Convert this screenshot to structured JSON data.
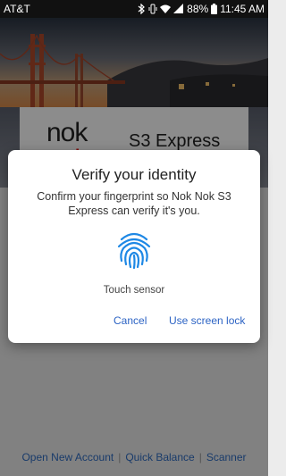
{
  "status_bar": {
    "carrier": "AT&T",
    "battery": "88%",
    "time": "11:45 AM",
    "icons": [
      "bluetooth-icon",
      "vibrate-icon",
      "wifi-icon",
      "signal-icon",
      "battery-icon"
    ]
  },
  "app": {
    "logo_text_top": "nok",
    "logo_text_bottom": "nok",
    "product_name": "S3 Express"
  },
  "bottom_links": [
    {
      "label": "Open New Account"
    },
    {
      "label": "Quick Balance"
    },
    {
      "label": "Scanner"
    }
  ],
  "dialog": {
    "title": "Verify your identity",
    "message": "Confirm your fingerprint so Nok Nok S3 Express can verify it's you.",
    "sensor_label": "Touch sensor",
    "cancel_label": "Cancel",
    "screen_lock_label": "Use screen lock",
    "icon": "fingerprint-icon"
  },
  "colors": {
    "accent": "#2c63c4",
    "logo_red": "#e22222",
    "fingerprint": "#1e88e5"
  }
}
